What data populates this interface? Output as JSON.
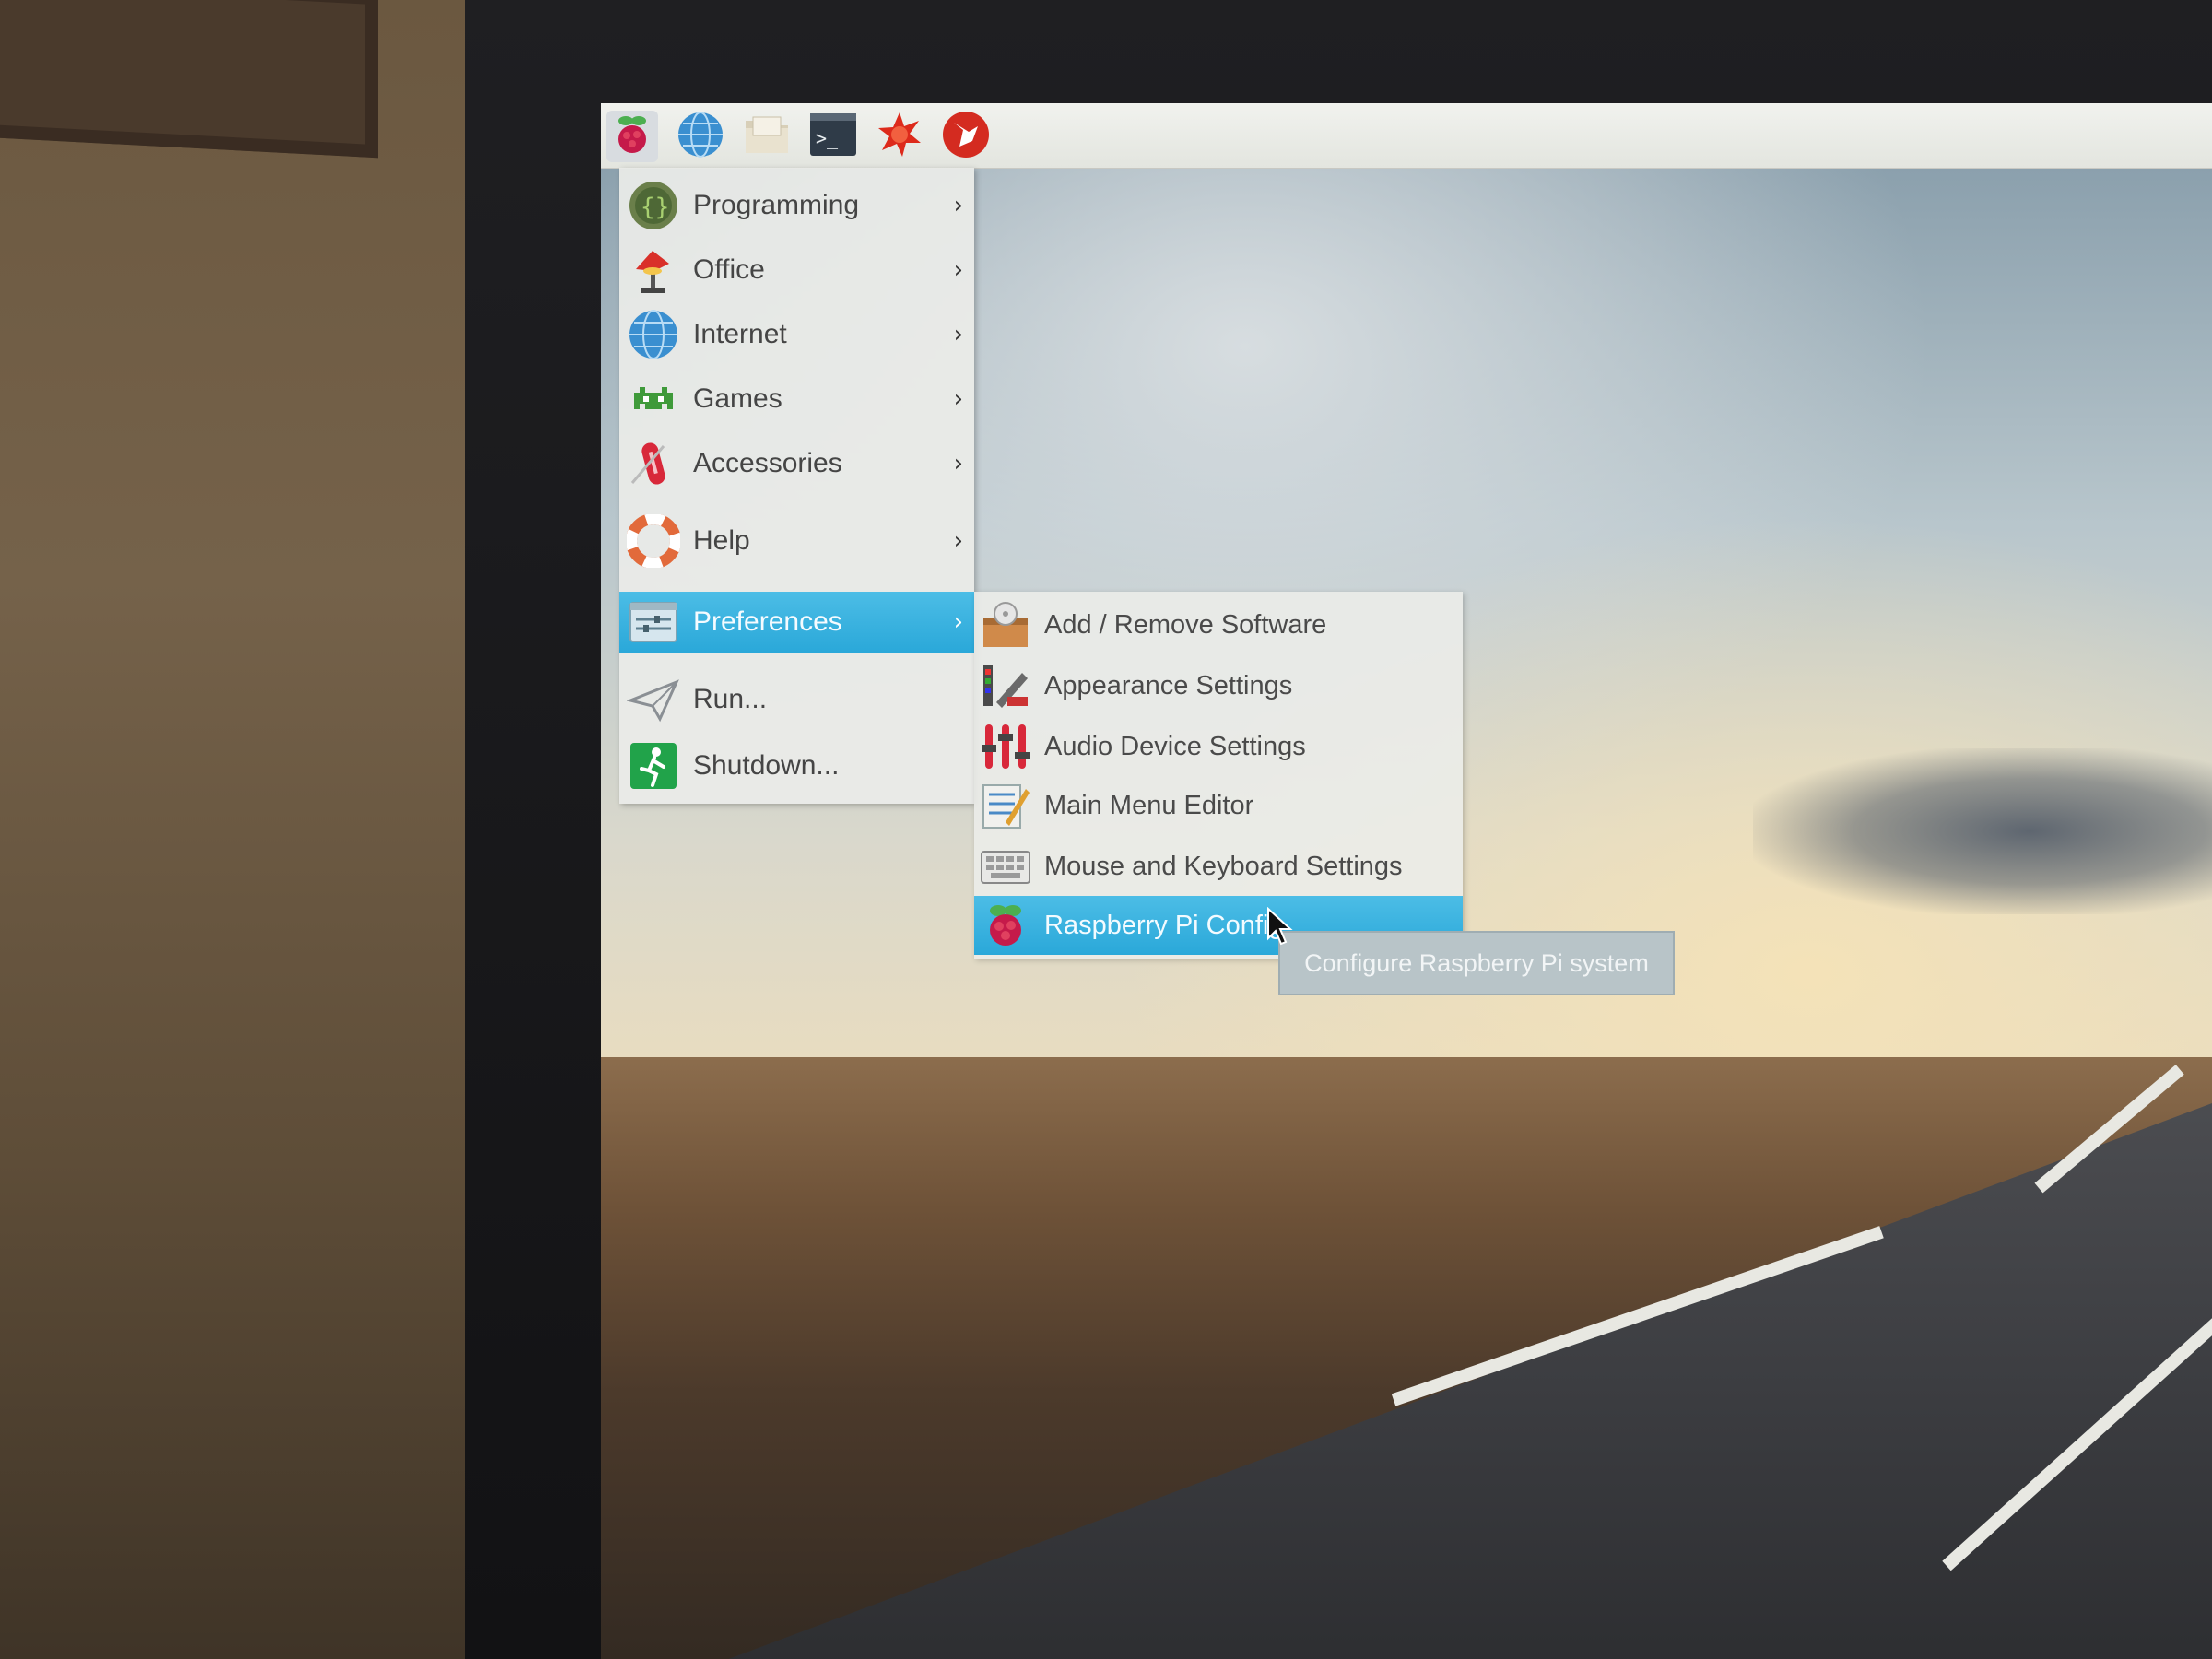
{
  "taskbar": {
    "launchers": [
      {
        "icon": "raspberry-menu-icon"
      },
      {
        "icon": "web-browser-icon"
      },
      {
        "icon": "file-manager-icon"
      },
      {
        "icon": "terminal-icon"
      },
      {
        "icon": "mathematica-icon"
      },
      {
        "icon": "wolfram-icon"
      }
    ]
  },
  "main_menu": {
    "items": [
      {
        "label": "Programming",
        "icon": "programming-icon",
        "has_submenu": true
      },
      {
        "label": "Office",
        "icon": "office-icon",
        "has_submenu": true
      },
      {
        "label": "Internet",
        "icon": "internet-icon",
        "has_submenu": true
      },
      {
        "label": "Games",
        "icon": "games-icon",
        "has_submenu": true
      },
      {
        "label": "Accessories",
        "icon": "accessories-icon",
        "has_submenu": true
      },
      {
        "label": "Help",
        "icon": "help-icon",
        "has_submenu": true
      },
      {
        "label": "Preferences",
        "icon": "preferences-icon",
        "has_submenu": true,
        "active": true
      },
      {
        "label": "Run...",
        "icon": "run-icon",
        "has_submenu": false
      },
      {
        "label": "Shutdown...",
        "icon": "shutdown-icon",
        "has_submenu": false
      }
    ],
    "chevron": "›"
  },
  "preferences_submenu": {
    "items": [
      {
        "label": "Add / Remove Software",
        "icon": "software-icon"
      },
      {
        "label": "Appearance Settings",
        "icon": "appearance-icon"
      },
      {
        "label": "Audio Device Settings",
        "icon": "audio-icon"
      },
      {
        "label": "Main Menu Editor",
        "icon": "menu-editor-icon"
      },
      {
        "label": "Mouse and Keyboard Settings",
        "icon": "keyboard-icon"
      },
      {
        "label": "Raspberry Pi Config",
        "icon": "raspberry-config-icon",
        "active": true
      }
    ]
  },
  "tooltip": {
    "text": "Configure Raspberry Pi system"
  },
  "colors": {
    "highlight": "#2aa8d9",
    "menu_bg": "#ebece8",
    "text": "#454545"
  }
}
